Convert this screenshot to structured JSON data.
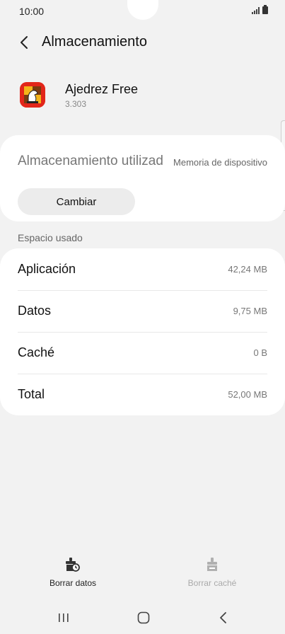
{
  "status_bar": {
    "time": "10:00"
  },
  "header": {
    "title": "Almacenamiento"
  },
  "app": {
    "name": "Ajedrez Free",
    "version": "3.303"
  },
  "storage": {
    "label": "Almacenamiento utilizad",
    "value": "Memoria de dispositivo",
    "change_button": "Cambiar"
  },
  "usage": {
    "section_title": "Espacio usado",
    "rows": [
      {
        "label": "Aplicación",
        "value": "42,24 MB"
      },
      {
        "label": "Datos",
        "value": "9,75 MB"
      },
      {
        "label": "Caché",
        "value": "0 B"
      },
      {
        "label": "Total",
        "value": "52,00 MB"
      }
    ]
  },
  "actions": {
    "clear_data": {
      "label": "Borrar datos",
      "icon": "clear-data-icon",
      "enabled": true
    },
    "clear_cache": {
      "label": "Borrar caché",
      "icon": "clear-cache-icon",
      "enabled": false
    }
  },
  "colors": {
    "background": "#f2f2f2",
    "card": "#ffffff",
    "app_icon_primary": "#e2261a",
    "disabled_text": "#aaaaaa"
  }
}
